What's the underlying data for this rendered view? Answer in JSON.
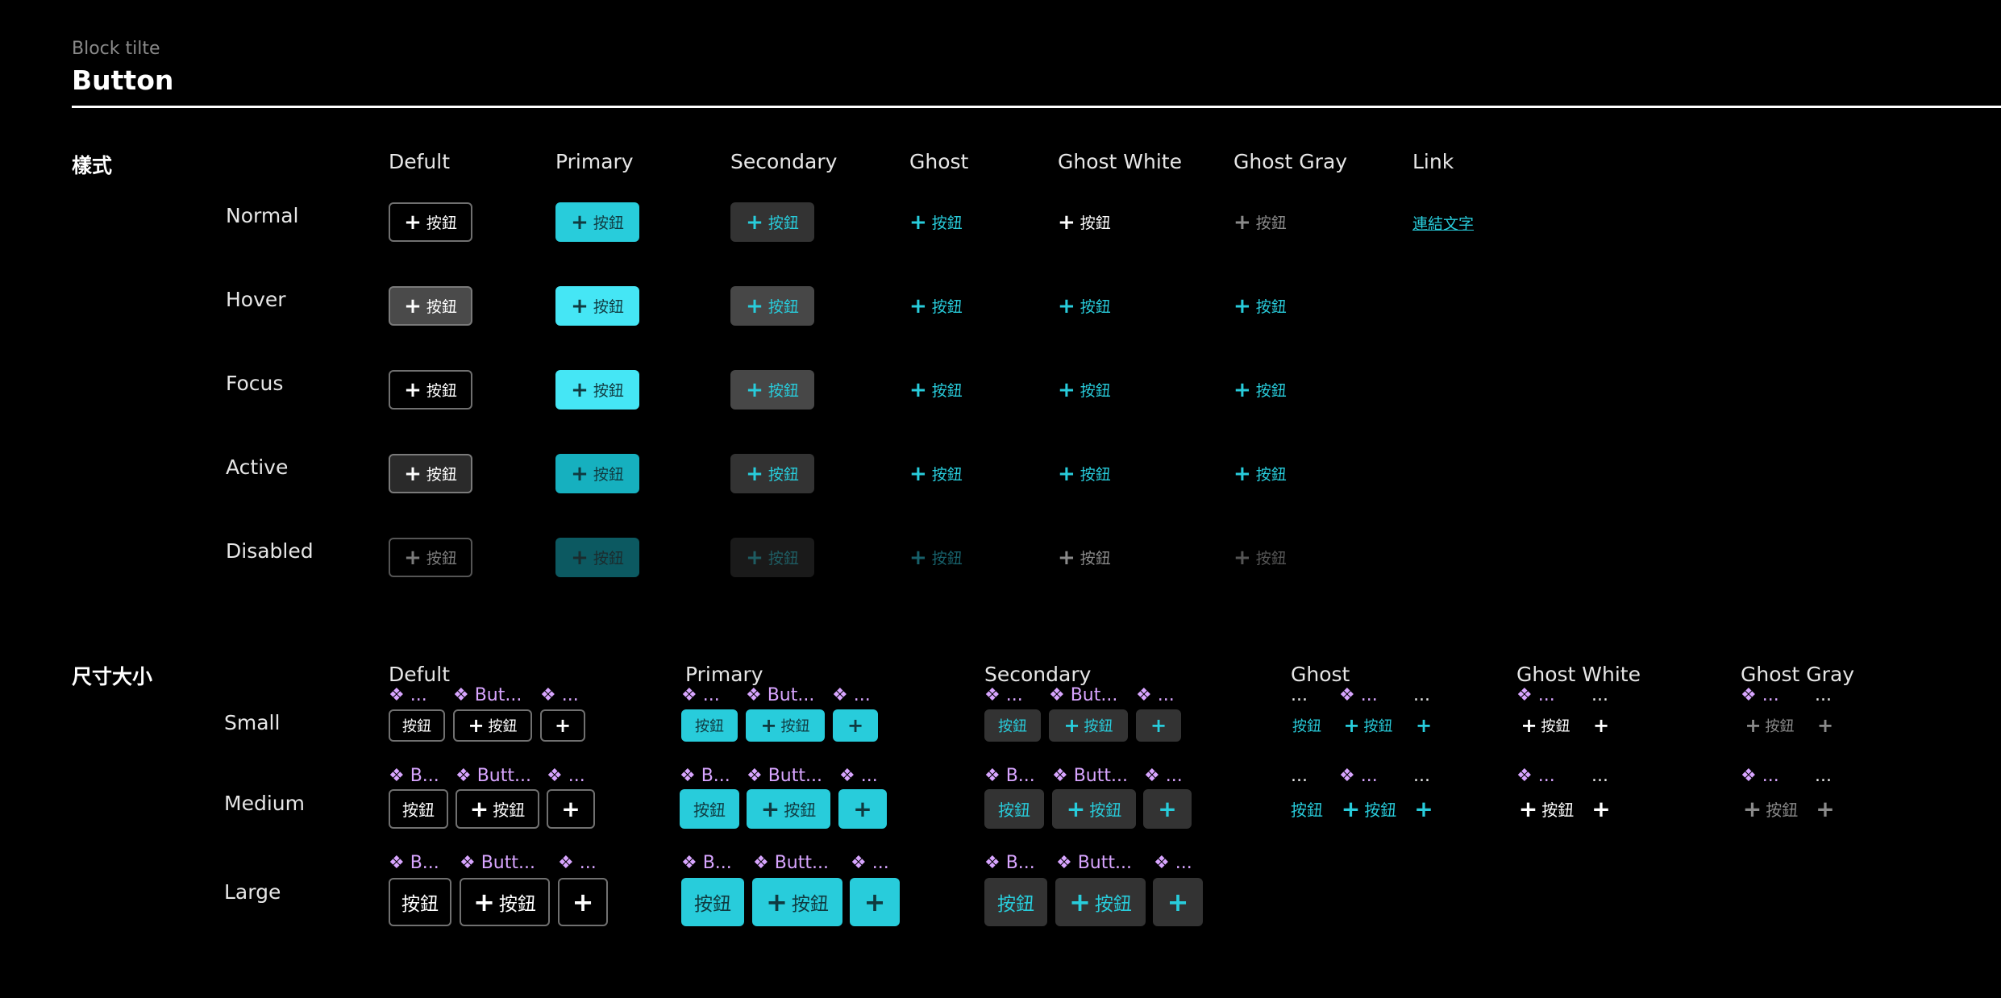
{
  "header": {
    "subtitle": "Block tilte",
    "title": "Button"
  },
  "styles_section": {
    "label": "樣式",
    "columns": [
      "Defult",
      "Primary",
      "Secondary",
      "Ghost",
      "Ghost White",
      "Ghost Gray",
      "Link"
    ],
    "rows": [
      "Normal",
      "Hover",
      "Focus",
      "Active",
      "Disabled"
    ],
    "button_text": "按鈕",
    "link_text": "連結文字"
  },
  "sizes_section": {
    "label": "尺寸大小",
    "columns": [
      "Defult",
      "Primary",
      "Secondary",
      "Ghost",
      "Ghost White",
      "Ghost Gray"
    ],
    "rows": [
      "Small",
      "Medium",
      "Large"
    ],
    "button_text": "按鈕",
    "component_labels": {
      "ellipsis": "...",
      "diamond_ellipsis": "❖ ...",
      "diamond_butt_small": "❖ Butt...",
      "diamond_butt": "❖ Butt...",
      "diamond_b": "❖ B...",
      "diamond_butt_s": "❖ But..."
    }
  },
  "icons": {
    "plus": "plus-icon",
    "component": "component-diamond-icon"
  },
  "colors": {
    "accent": "#28ccdb",
    "component_label": "#d8a5ff",
    "background": "#000000"
  }
}
